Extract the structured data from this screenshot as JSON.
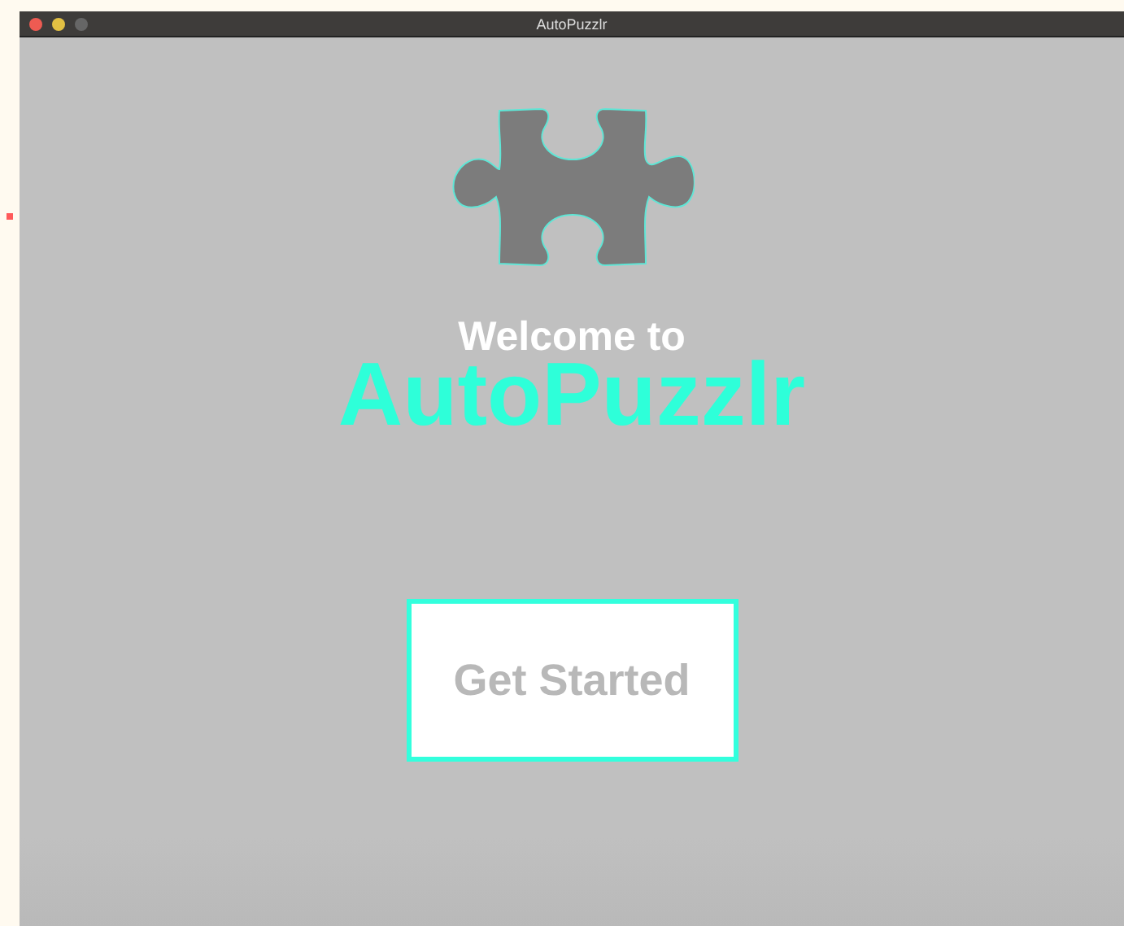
{
  "window": {
    "title": "AutoPuzzlr"
  },
  "welcome": {
    "subtitle": "Welcome to",
    "title": "AutoPuzzlr"
  },
  "buttons": [
    {
      "label": "Get Started"
    }
  ]
}
